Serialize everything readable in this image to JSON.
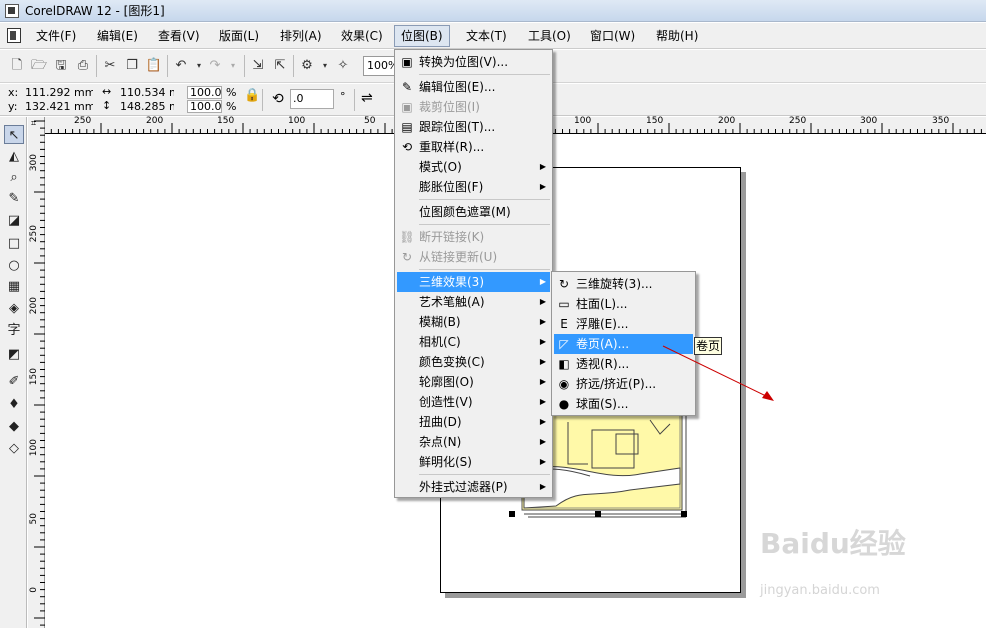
{
  "window": {
    "title": "CorelDRAW 12 - [图形1]"
  },
  "menubar": {
    "items": [
      {
        "label": "文件(F)"
      },
      {
        "label": "编辑(E)"
      },
      {
        "label": "查看(V)"
      },
      {
        "label": "版面(L)"
      },
      {
        "label": "排列(A)"
      },
      {
        "label": "效果(C)"
      },
      {
        "label": "位图(B)"
      },
      {
        "label": "文本(T)"
      },
      {
        "label": "工具(O)"
      },
      {
        "label": "窗口(W)"
      },
      {
        "label": "帮助(H)"
      }
    ]
  },
  "toolbar": {
    "zoom": "100%"
  },
  "propbar": {
    "x_label": "x:",
    "x_value": "111.292 mm",
    "y_label": "y:",
    "y_value": "132.421 mm",
    "width_value": "110.534 mr",
    "height_value": "148.285 mr",
    "scale_x": "100.0",
    "scale_y": "100.0",
    "percent": "%",
    "angle": ".0",
    "degree": "°"
  },
  "rulers": {
    "h_ticks": [
      "250",
      "200",
      "150",
      "100",
      "50",
      "100",
      "150",
      "200",
      "250",
      "300",
      "350"
    ],
    "v_ticks": [
      "300",
      "250",
      "200",
      "150",
      "100",
      "50",
      "0"
    ]
  },
  "bitmap_menu": {
    "items": [
      {
        "label": "转换为位图(V)...",
        "icon": "convert-to-bitmap-icon",
        "glyph": "▣"
      },
      {
        "label": "编辑位图(E)...",
        "icon": "edit-bitmap-icon",
        "glyph": "✎"
      },
      {
        "label": "裁剪位图(I)",
        "icon": "crop-bitmap-icon",
        "glyph": "▣",
        "disabled": true
      },
      {
        "label": "跟踪位图(T)...",
        "icon": "trace-bitmap-icon",
        "glyph": "▤"
      },
      {
        "label": "重取样(R)...",
        "icon": "resample-icon",
        "glyph": "⟲"
      },
      {
        "label": "模式(O)",
        "submenu": true
      },
      {
        "label": "膨胀位图(F)",
        "submenu": true
      },
      {
        "label": "位图颜色遮罩(M)"
      },
      {
        "label": "断开链接(K)",
        "icon": "break-link-icon",
        "glyph": "⛓",
        "disabled": true
      },
      {
        "label": "从链接更新(U)",
        "icon": "update-link-icon",
        "glyph": "↻",
        "disabled": true
      },
      {
        "label": "三维效果(3)",
        "submenu": true,
        "highlighted": true
      },
      {
        "label": "艺术笔触(A)",
        "submenu": true
      },
      {
        "label": "模糊(B)",
        "submenu": true
      },
      {
        "label": "相机(C)",
        "submenu": true
      },
      {
        "label": "颜色变换(C)",
        "submenu": true
      },
      {
        "label": "轮廓图(O)",
        "submenu": true
      },
      {
        "label": "创造性(V)",
        "submenu": true
      },
      {
        "label": "扭曲(D)",
        "submenu": true
      },
      {
        "label": "杂点(N)",
        "submenu": true
      },
      {
        "label": "鲜明化(S)",
        "submenu": true
      },
      {
        "label": "外挂式过滤器(P)",
        "submenu": true
      }
    ]
  },
  "effects3d_menu": {
    "items": [
      {
        "label": "三维旋转(3)...",
        "icon": "3d-rotate-icon",
        "glyph": "↻"
      },
      {
        "label": "柱面(L)...",
        "icon": "cylinder-icon",
        "glyph": "▭"
      },
      {
        "label": "浮雕(E)...",
        "icon": "emboss-icon",
        "glyph": "E"
      },
      {
        "label": "卷页(A)...",
        "icon": "page-curl-icon",
        "glyph": "◸",
        "highlighted": true
      },
      {
        "label": "透视(R)...",
        "icon": "perspective-icon",
        "glyph": "◧"
      },
      {
        "label": "挤远/挤近(P)...",
        "icon": "pinch-punch-icon",
        "glyph": "◉"
      },
      {
        "label": "球面(S)...",
        "icon": "sphere-icon",
        "glyph": "●"
      }
    ]
  },
  "tooltip": {
    "text": "卷页"
  },
  "watermark": {
    "text": "Baidu经验",
    "sub": "jingyan.baidu.com"
  },
  "colors": {
    "highlight": "#3399ff",
    "tooltip_bg": "#ffffe1",
    "artwork": "#fff9a8",
    "arrow": "#cc0000"
  }
}
